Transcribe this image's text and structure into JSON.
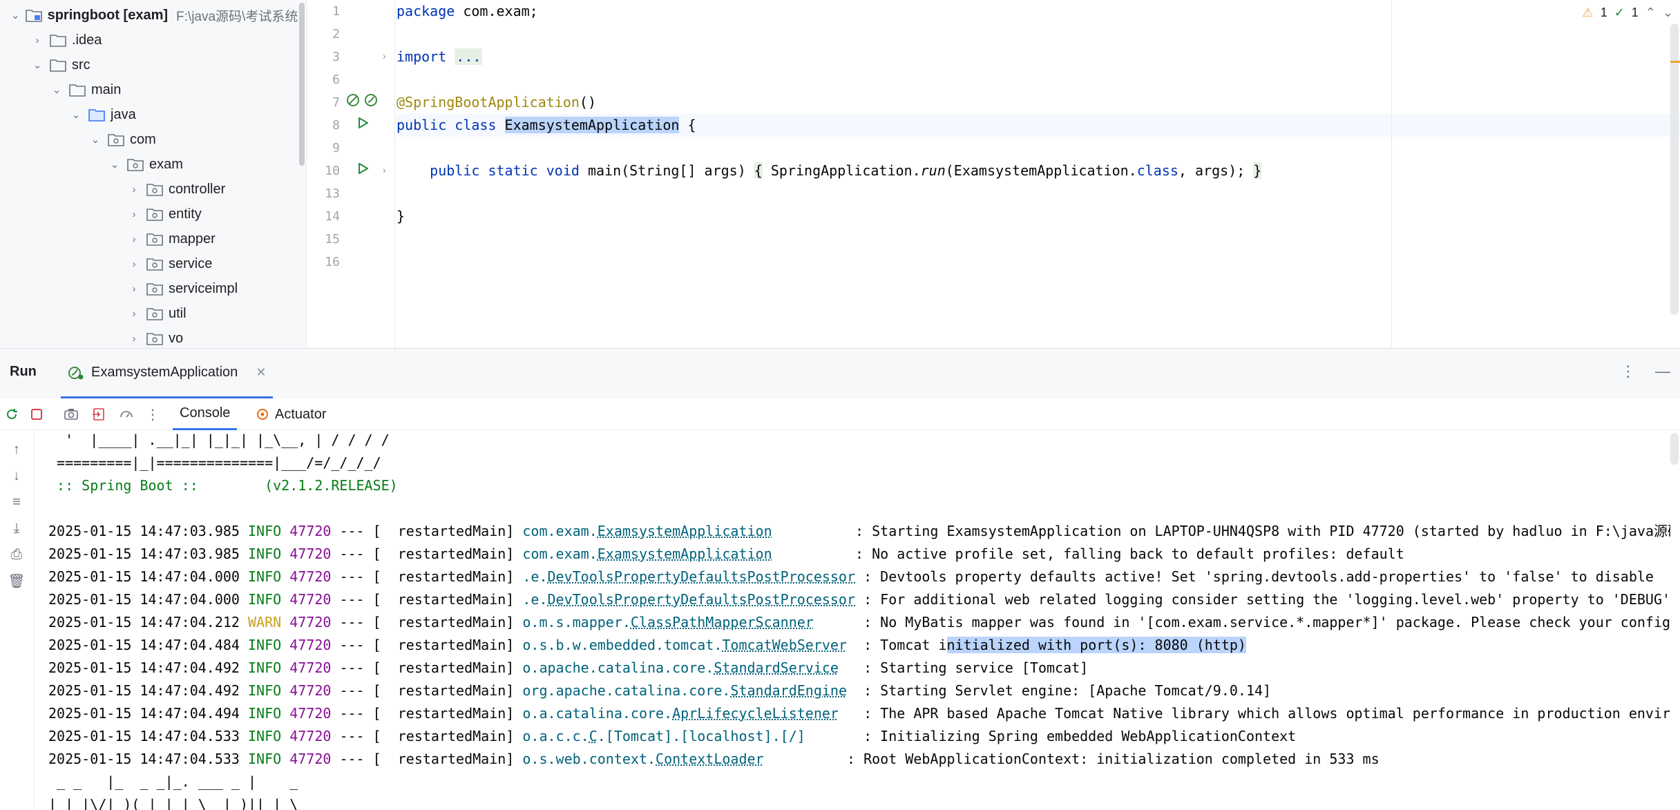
{
  "project_tree": {
    "root": {
      "name": "springboot [exam]",
      "path": "F:\\java源码\\考试系统"
    },
    "items": [
      {
        "name": ".idea",
        "type": "folder",
        "expanded": false
      },
      {
        "name": "src",
        "type": "folder",
        "expanded": true
      },
      {
        "name": "main",
        "type": "folder",
        "expanded": true
      },
      {
        "name": "java",
        "type": "source-folder",
        "expanded": true
      },
      {
        "name": "com",
        "type": "package",
        "expanded": true
      },
      {
        "name": "exam",
        "type": "package",
        "expanded": true
      },
      {
        "name": "controller",
        "type": "package",
        "expanded": false
      },
      {
        "name": "entity",
        "type": "package",
        "expanded": false
      },
      {
        "name": "mapper",
        "type": "package",
        "expanded": false
      },
      {
        "name": "service",
        "type": "package",
        "expanded": false
      },
      {
        "name": "serviceimpl",
        "type": "package",
        "expanded": false
      },
      {
        "name": "util",
        "type": "package",
        "expanded": false
      },
      {
        "name": "vo",
        "type": "package",
        "expanded": false
      }
    ]
  },
  "editor": {
    "line_numbers": [
      "1",
      "2",
      "3",
      "6",
      "7",
      "8",
      "9",
      "10",
      "13",
      "14",
      "15",
      "16"
    ],
    "lines": {
      "l1_kw": "package",
      "l1_rest": " com.exam;",
      "l3_kw": "import",
      "l3_fold": "...",
      "l7_at": "@",
      "l7_ann": "SpringBootApplication",
      "l7_rest": "()",
      "l8_kw": "public class",
      "l8_sp": " ",
      "l8_cls": "ExamsystemApplication",
      "l8_rest": " {",
      "l10_indent": "    ",
      "l10_kw": "public static void",
      "l10_a": " main(String[] args) ",
      "l10_brace1": "{",
      "l10_b": " SpringApplication.",
      "l10_run": "run",
      "l10_c": "(ExamsystemApplication.",
      "l10_class": "class",
      "l10_d": ", args); ",
      "l10_brace2": "}",
      "l14": "}"
    },
    "inspections": {
      "warnings": "1",
      "ok": "1"
    }
  },
  "run_window": {
    "title": "Run",
    "tab_label": "ExamsystemApplication",
    "console_tab": "Console",
    "actuator_tab": "Actuator"
  },
  "console": {
    "banner": [
      "  '  |____| .__|_| |_|_| |_\\__, | / / / /",
      " =========|_|==============|___/=/_/_/_/",
      " :: Spring Boot ::        (v2.1.2.RELEASE)"
    ],
    "logs": [
      {
        "time": "2025-01-15 14:47:03.985",
        "level": "INFO",
        "pid": "47720",
        "thread": " --- [  restartedMain] ",
        "logger_prefix": "com.exam.",
        "logger_link": "ExamsystemApplication",
        "pad": "          ",
        "message": ": Starting ExamsystemApplication on LAPTOP-UHN4QSP8 with PID 47720 (started by hadluo in F:\\java源码"
      },
      {
        "time": "2025-01-15 14:47:03.985",
        "level": "INFO",
        "pid": "47720",
        "thread": " --- [  restartedMain] ",
        "logger_prefix": "com.exam.",
        "logger_link": "ExamsystemApplication",
        "pad": "          ",
        "message": ": No active profile set, falling back to default profiles: default"
      },
      {
        "time": "2025-01-15 14:47:04.000",
        "level": "INFO",
        "pid": "47720",
        "thread": " --- [  restartedMain] ",
        "logger_prefix": ".e.",
        "logger_link": "DevToolsPropertyDefaultsPostProcessor",
        "pad": " ",
        "message": ": Devtools property defaults active! Set 'spring.devtools.add-properties' to 'false' to disable"
      },
      {
        "time": "2025-01-15 14:47:04.000",
        "level": "INFO",
        "pid": "47720",
        "thread": " --- [  restartedMain] ",
        "logger_prefix": ".e.",
        "logger_link": "DevToolsPropertyDefaultsPostProcessor",
        "pad": " ",
        "message": ": For additional web related logging consider setting the 'logging.level.web' property to 'DEBUG'"
      },
      {
        "time": "2025-01-15 14:47:04.212",
        "level": "WARN",
        "pid": "47720",
        "thread": " --- [  restartedMain] ",
        "logger_prefix": "o.m.s.mapper.",
        "logger_link": "ClassPathMapperScanner",
        "pad": "      ",
        "message": ": No MyBatis mapper was found in '[com.exam.service.*.mapper*]' package. Please check your configu"
      },
      {
        "time": "2025-01-15 14:47:04.484",
        "level": "INFO",
        "pid": "47720",
        "thread": " --- [  restartedMain] ",
        "logger_prefix": "o.s.b.w.embedded.tomcat.",
        "logger_link": "TomcatWebServer",
        "pad": "  ",
        "message_a": ": Tomcat i",
        "message_sel": "nitialized with port(s): 8080 (http)"
      },
      {
        "time": "2025-01-15 14:47:04.492",
        "level": "INFO",
        "pid": "47720",
        "thread": " --- [  restartedMain] ",
        "logger_prefix": "o.apache.catalina.core.",
        "logger_link": "StandardService",
        "pad": "   ",
        "message": ": Starting service [Tomcat]"
      },
      {
        "time": "2025-01-15 14:47:04.492",
        "level": "INFO",
        "pid": "47720",
        "thread": " --- [  restartedMain] ",
        "logger_prefix": "org.apache.catalina.core.",
        "logger_link": "StandardEngine",
        "pad": "  ",
        "message": ": Starting Servlet engine: [Apache Tomcat/9.0.14]"
      },
      {
        "time": "2025-01-15 14:47:04.494",
        "level": "INFO",
        "pid": "47720",
        "thread": " --- [  restartedMain] ",
        "logger_prefix": "o.a.catalina.core.",
        "logger_link": "AprLifecycleListener",
        "pad": "   ",
        "message": ": The APR based Apache Tomcat Native library which allows optimal performance in production enviro"
      },
      {
        "time": "2025-01-15 14:47:04.533",
        "level": "INFO",
        "pid": "47720",
        "thread": " --- [  restartedMain] ",
        "logger_prefix": "o.a.c.c.",
        "logger_link": "C",
        "logger_suffix": ".[Tomcat].[localhost].[/]",
        "pad": "       ",
        "message": ": Initializing Spring embedded WebApplicationContext"
      },
      {
        "time": "2025-01-15 14:47:04.533",
        "level": "INFO",
        "pid": "47720",
        "thread": " --- [  restartedMain] ",
        "logger_prefix": "o.s.web.context.",
        "logger_link": "ContextLoader",
        "pad": "          ",
        "message": ": Root WebApplicationContext: initialization completed in 533 ms"
      }
    ],
    "trailing": [
      " _ _   |_  _ _|_. ___ _ |    _",
      "| | |\\/|_)(_| | |_\\  |_)||_|_\\"
    ]
  },
  "colors": {
    "accent": "#3574f0",
    "info": "#067d17",
    "warn": "#c7a21b",
    "pid": "#871094",
    "logger": "#00627a",
    "keyword": "#0033b3",
    "annotation": "#9e880d",
    "selection": "#bad4fb"
  }
}
